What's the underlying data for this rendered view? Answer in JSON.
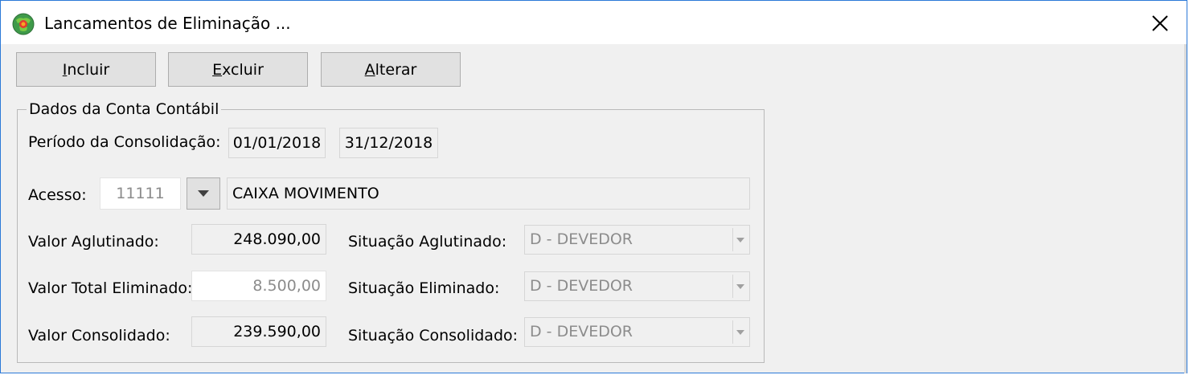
{
  "window": {
    "title": "Lancamentos de Eliminação ..."
  },
  "toolbar": {
    "incluir": {
      "pre": "",
      "u": "I",
      "post": "ncluir"
    },
    "excluir": {
      "pre": "",
      "u": "E",
      "post": "xcluir"
    },
    "alterar": {
      "pre": "",
      "u": "A",
      "post": "lterar"
    }
  },
  "group": {
    "legend": "Dados da Conta Contábil",
    "periodo_label": "Período da Consolidação:",
    "periodo_inicio": "01/01/2018",
    "periodo_fim": "31/12/2018",
    "acesso_label": "Acesso:",
    "acesso_codigo": "11111",
    "acesso_descricao": "CAIXA MOVIMENTO",
    "valor_aglutinado_label": "Valor Aglutinado:",
    "valor_aglutinado": "248.090,00",
    "valor_eliminado_label": "Valor Total Eliminado:",
    "valor_eliminado": "8.500,00",
    "valor_consolidado_label": "Valor Consolidado:",
    "valor_consolidado": "239.590,00",
    "situacao_aglutinado_label": "Situação Aglutinado:",
    "situacao_aglutinado": "D - DEVEDOR",
    "situacao_eliminado_label": "Situação Eliminado:",
    "situacao_eliminado": "D - DEVEDOR",
    "situacao_consolidado_label": "Situação Consolidado:",
    "situacao_consolidado": "D - DEVEDOR"
  },
  "icons": {
    "app": "globe-icon",
    "close": "close-icon",
    "dropdown": "chevron-down-icon"
  },
  "colors": {
    "window_border": "#2b79d8",
    "background": "#f0f0f0",
    "button_face": "#e1e1e1",
    "disabled_text": "#8c8c8c"
  }
}
